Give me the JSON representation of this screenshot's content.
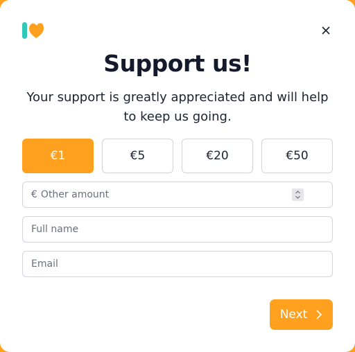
{
  "header": {
    "title": "Support us!",
    "subtitle": "Your support is greatly appreciated and will help to keep us going."
  },
  "amounts": [
    {
      "label": "€1",
      "selected": true
    },
    {
      "label": "€5",
      "selected": false
    },
    {
      "label": "€20",
      "selected": false
    },
    {
      "label": "€50",
      "selected": false
    }
  ],
  "form": {
    "currency_symbol": "€",
    "other_amount_placeholder": "Other amount",
    "full_name_placeholder": "Full name",
    "email_placeholder": "Email"
  },
  "actions": {
    "next_label": "Next"
  },
  "colors": {
    "accent": "#ffa01f",
    "logo_teal": "#2ec9b8",
    "text": "#141a2b"
  },
  "icons": {
    "logo": "ko-fi-heart-logo",
    "close": "close-icon",
    "next": "chevron-right-icon"
  }
}
